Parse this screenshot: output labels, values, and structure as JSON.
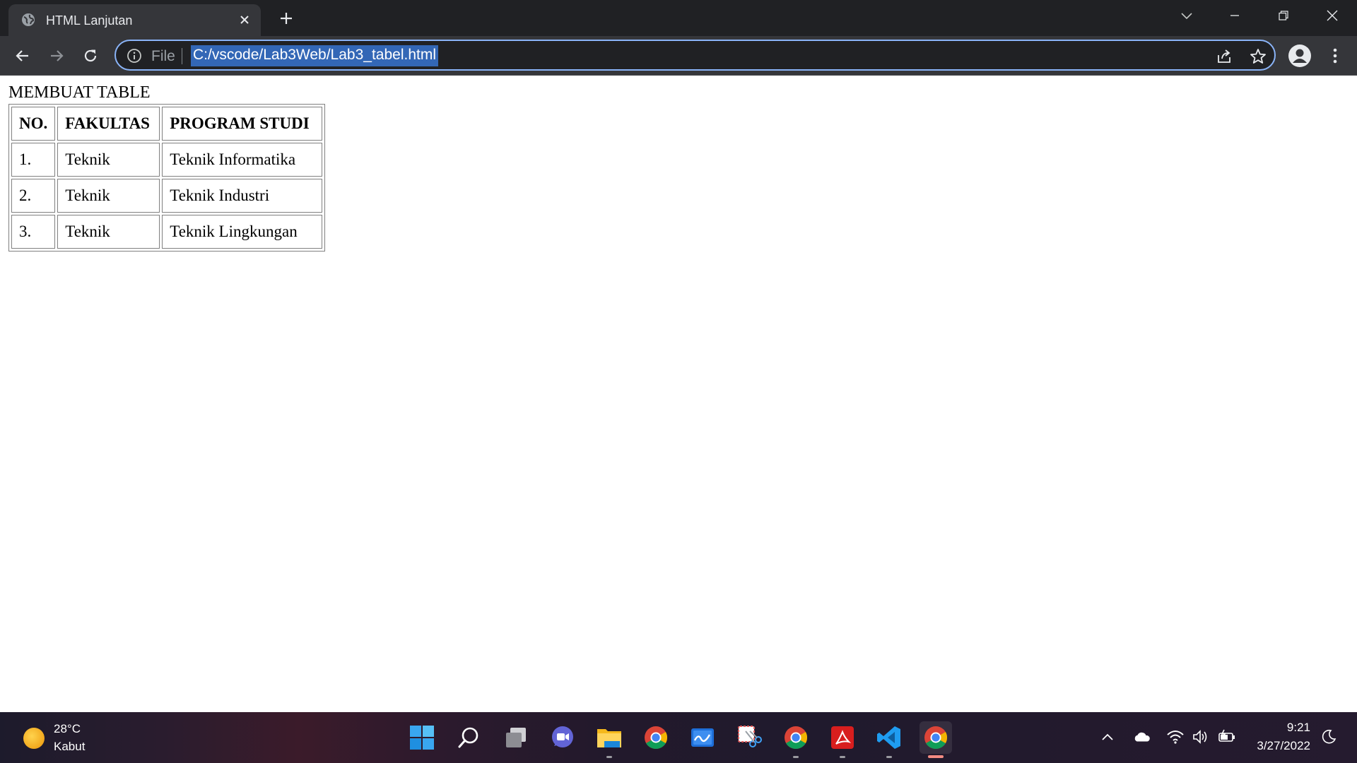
{
  "browser": {
    "tab_title": "HTML Lanjutan",
    "address_scheme": "File",
    "address_url": "C:/vscode/Lab3Web/Lab3_tabel.html"
  },
  "page": {
    "heading": "MEMBUAT TABLE",
    "table": {
      "headers": [
        "NO.",
        "FAKULTAS",
        "PROGRAM STUDI"
      ],
      "rows": [
        [
          "1.",
          "Teknik",
          "Teknik Informatika"
        ],
        [
          "2.",
          "Teknik",
          "Teknik Industri"
        ],
        [
          "3.",
          "Teknik",
          "Teknik Lingkungan"
        ]
      ]
    }
  },
  "taskbar": {
    "weather_temp": "28°C",
    "weather_desc": "Kabut",
    "time": "9:21",
    "date": "3/27/2022",
    "pinned_apps": [
      "start-icon",
      "search-icon",
      "task-view-icon",
      "teams-chat-icon",
      "file-explorer-icon",
      "chrome-icon",
      "whiteboard-icon",
      "snipping-tool-icon",
      "chrome-icon",
      "acrobat-icon",
      "vscode-icon",
      "chrome-icon"
    ]
  },
  "colors": {
    "accent_focus": "#8ab4f8",
    "url_selection": "#3367b6",
    "chrome_dark": "#202124",
    "chrome_tab": "#35363a"
  }
}
